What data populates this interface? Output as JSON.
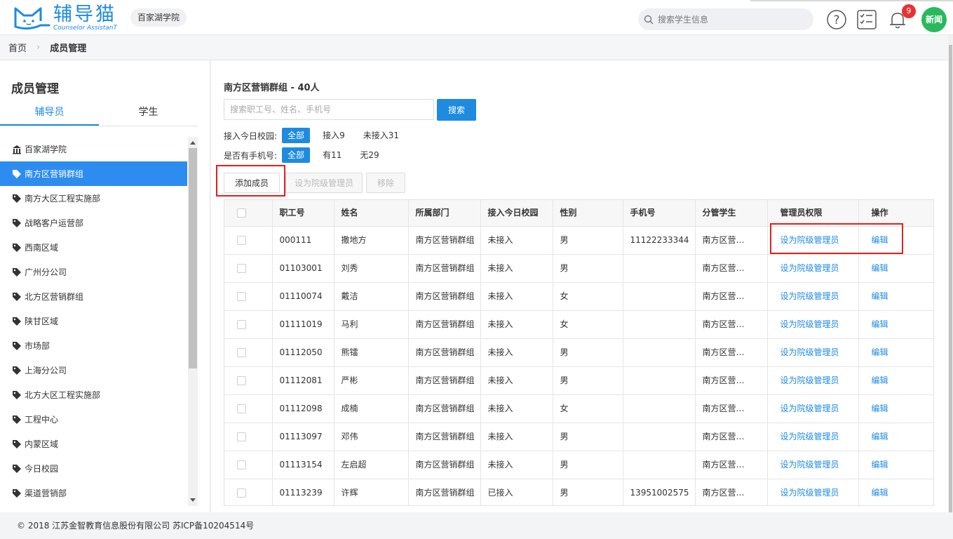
{
  "header": {
    "logo_title": "辅导猫",
    "logo_subtitle": "Counselor AssistanT",
    "school": "百家湖学院",
    "search_placeholder": "搜索学生信息",
    "notification_count": "9",
    "avatar_text": "新闻"
  },
  "breadcrumb": {
    "home": "首页",
    "current": "成员管理"
  },
  "sidebar": {
    "title": "成员管理",
    "tabs": [
      {
        "label": "辅导员"
      },
      {
        "label": "学生"
      }
    ],
    "tree": [
      {
        "label": "百家湖学院",
        "icon": "building-icon"
      },
      {
        "label": "南方区营销群组",
        "icon": "tag-icon"
      },
      {
        "label": "南方大区工程实施部",
        "icon": "tag-icon"
      },
      {
        "label": "战略客户运营部",
        "icon": "tag-icon"
      },
      {
        "label": "西南区域",
        "icon": "tag-icon"
      },
      {
        "label": "广州分公司",
        "icon": "tag-icon"
      },
      {
        "label": "北方区营销群组",
        "icon": "tag-icon"
      },
      {
        "label": "陕甘区域",
        "icon": "tag-icon"
      },
      {
        "label": "市场部",
        "icon": "tag-icon"
      },
      {
        "label": "上海分公司",
        "icon": "tag-icon"
      },
      {
        "label": "北方大区工程实施部",
        "icon": "tag-icon"
      },
      {
        "label": "工程中心",
        "icon": "tag-icon"
      },
      {
        "label": "内蒙区域",
        "icon": "tag-icon"
      },
      {
        "label": "今日校园",
        "icon": "tag-icon"
      },
      {
        "label": "渠道营销部",
        "icon": "tag-icon"
      }
    ]
  },
  "main": {
    "group_title": "南方区营销群组 - 40人",
    "search_placeholder": "搜索职工号、姓名、手机号",
    "search_button": "搜索",
    "filter_campus": {
      "label": "接入今日校园:",
      "all": "全部",
      "yes": "接入9",
      "no": "未接入31"
    },
    "filter_phone": {
      "label": "是否有手机号:",
      "all": "全部",
      "yes": "有11",
      "no": "无29"
    },
    "add_member": "添加成员",
    "set_admin": "设为院级管理员",
    "remove": "移除"
  },
  "table": {
    "headers": {
      "id": "职工号",
      "name": "姓名",
      "dept": "所属部门",
      "campus": "接入今日校园",
      "gender": "性别",
      "phone": "手机号",
      "students": "分管学生",
      "admin": "管理员权限",
      "op": "操作"
    },
    "rows": [
      {
        "id": "000111",
        "name": "撒地方",
        "dept": "南方区营销群组",
        "campus": "未接入",
        "gender": "男",
        "phone": "11122233344",
        "students": "南方区营…",
        "admin": "设为院级管理员",
        "op": "编辑"
      },
      {
        "id": "01103001",
        "name": "刘秀",
        "dept": "南方区营销群组",
        "campus": "未接入",
        "gender": "男",
        "phone": "",
        "students": "南方区营…",
        "admin": "设为院级管理员",
        "op": "编辑"
      },
      {
        "id": "01110074",
        "name": "戴洁",
        "dept": "南方区营销群组",
        "campus": "未接入",
        "gender": "女",
        "phone": "",
        "students": "南方区营…",
        "admin": "设为院级管理员",
        "op": "编辑"
      },
      {
        "id": "01111019",
        "name": "马利",
        "dept": "南方区营销群组",
        "campus": "未接入",
        "gender": "女",
        "phone": "",
        "students": "南方区营…",
        "admin": "设为院级管理员",
        "op": "编辑"
      },
      {
        "id": "01112050",
        "name": "熊镭",
        "dept": "南方区营销群组",
        "campus": "未接入",
        "gender": "男",
        "phone": "",
        "students": "南方区营…",
        "admin": "设为院级管理员",
        "op": "编辑"
      },
      {
        "id": "01112081",
        "name": "严彬",
        "dept": "南方区营销群组",
        "campus": "未接入",
        "gender": "男",
        "phone": "",
        "students": "南方区营…",
        "admin": "设为院级管理员",
        "op": "编辑"
      },
      {
        "id": "01112098",
        "name": "成楠",
        "dept": "南方区营销群组",
        "campus": "未接入",
        "gender": "女",
        "phone": "",
        "students": "南方区营…",
        "admin": "设为院级管理员",
        "op": "编辑"
      },
      {
        "id": "01113097",
        "name": "邓伟",
        "dept": "南方区营销群组",
        "campus": "未接入",
        "gender": "男",
        "phone": "",
        "students": "南方区营…",
        "admin": "设为院级管理员",
        "op": "编辑"
      },
      {
        "id": "01113154",
        "name": "左启超",
        "dept": "南方区营销群组",
        "campus": "未接入",
        "gender": "男",
        "phone": "",
        "students": "南方区营…",
        "admin": "设为院级管理员",
        "op": "编辑"
      },
      {
        "id": "01113239",
        "name": "许辉",
        "dept": "南方区营销群组",
        "campus": "已接入",
        "gender": "男",
        "phone": "13951002575",
        "students": "南方区营…",
        "admin": "设为院级管理员",
        "op": "编辑"
      }
    ]
  },
  "footer": {
    "text": "© 2018 江苏金智教育信息股份有限公司 苏ICP备10204514号"
  },
  "colors": {
    "accent": "#1e8be0",
    "active_tree": "#2d8cf0",
    "highlight": "#e02020",
    "badge": "#e83232",
    "avatar": "#29b95c"
  }
}
